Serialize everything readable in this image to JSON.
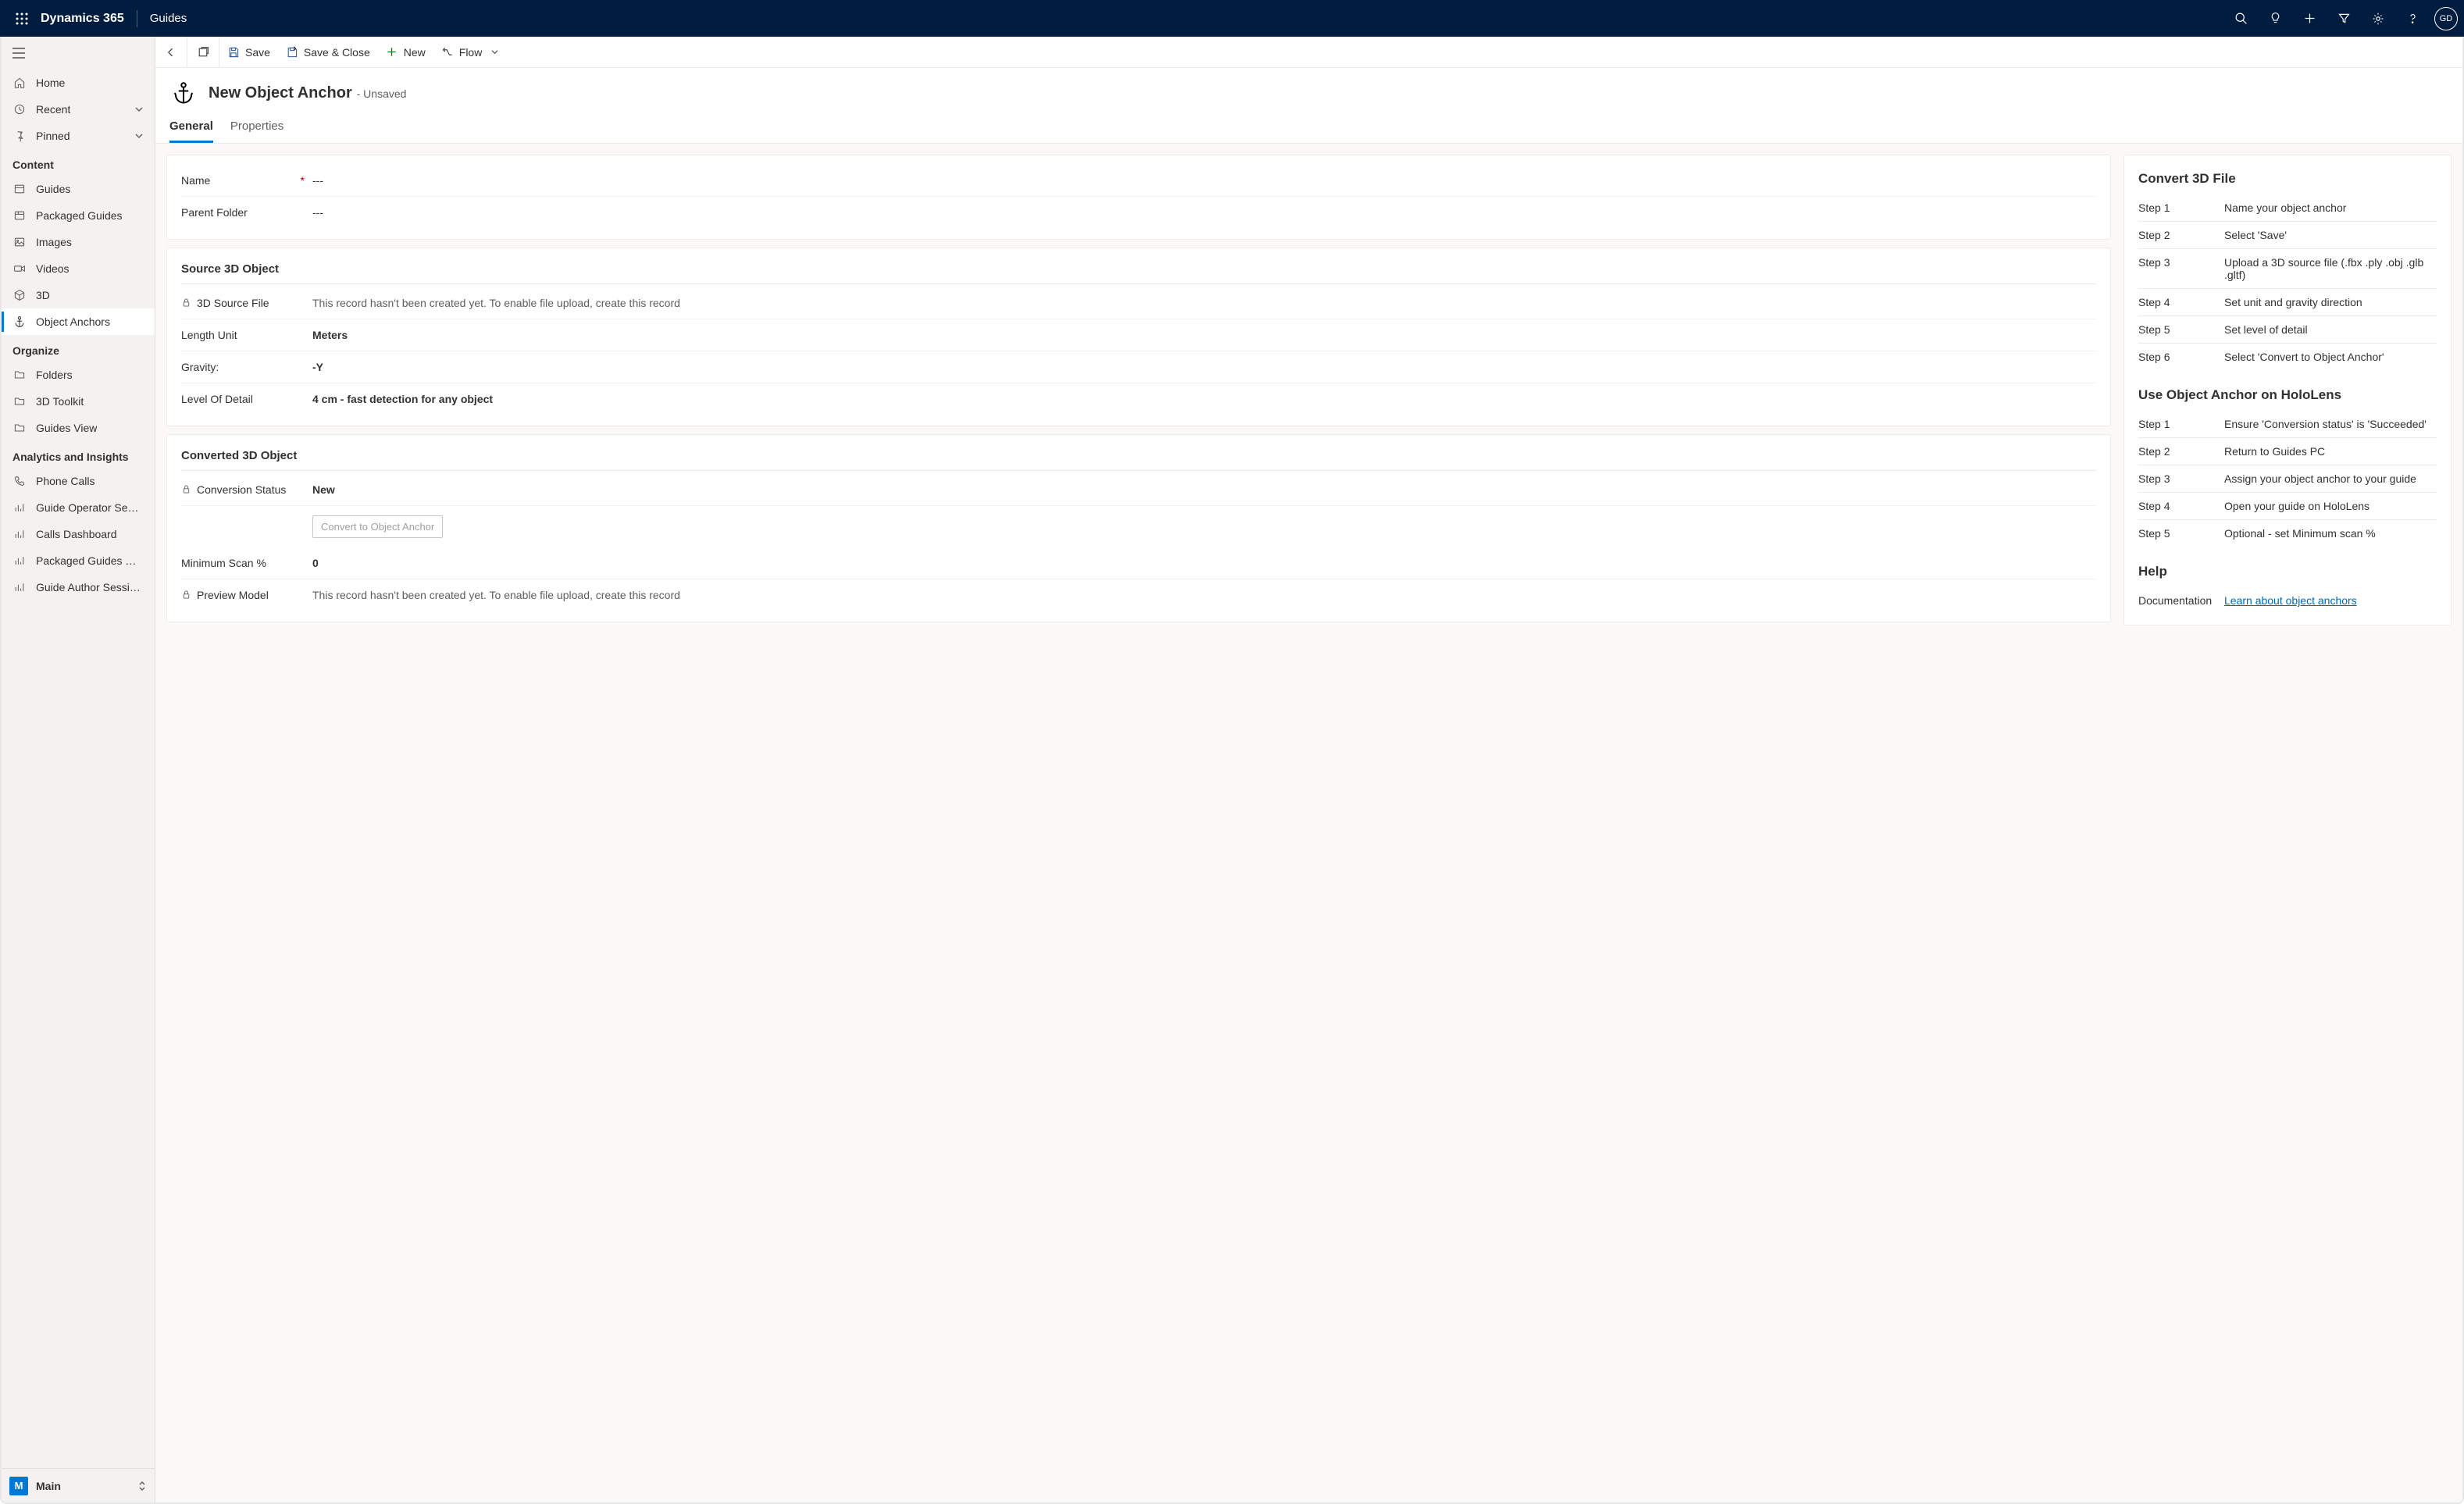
{
  "topbar": {
    "brand": "Dynamics 365",
    "app": "Guides",
    "avatar": "GD"
  },
  "leftnav": {
    "home": "Home",
    "recent": "Recent",
    "pinned": "Pinned",
    "sections": {
      "content": {
        "title": "Content",
        "items": [
          "Guides",
          "Packaged Guides",
          "Images",
          "Videos",
          "3D",
          "Object Anchors"
        ]
      },
      "organize": {
        "title": "Organize",
        "items": [
          "Folders",
          "3D Toolkit",
          "Guides View"
        ]
      },
      "analytics": {
        "title": "Analytics and Insights",
        "items": [
          "Phone Calls",
          "Guide Operator Sessi...",
          "Calls Dashboard",
          "Packaged Guides Op...",
          "Guide Author Sessions"
        ]
      }
    },
    "area": {
      "badge": "M",
      "label": "Main"
    }
  },
  "cmdbar": {
    "save": "Save",
    "save_close": "Save & Close",
    "new": "New",
    "flow": "Flow"
  },
  "record": {
    "title": "New Object Anchor",
    "status": "- Unsaved"
  },
  "tabs": [
    "General",
    "Properties"
  ],
  "form": {
    "name": {
      "label": "Name",
      "value": "---"
    },
    "parent": {
      "label": "Parent Folder",
      "value": "---"
    },
    "source_section": "Source 3D Object",
    "source_file": {
      "label": "3D Source File",
      "value": "This record hasn't been created yet. To enable file upload, create this record"
    },
    "length_unit": {
      "label": "Length Unit",
      "value": "Meters"
    },
    "gravity": {
      "label": "Gravity:",
      "value": "-Y"
    },
    "lod": {
      "label": "Level Of Detail",
      "value": "4 cm - fast detection for any object"
    },
    "converted_section": "Converted 3D Object",
    "conv_status": {
      "label": "Conversion Status",
      "value": "New"
    },
    "convert_btn": "Convert to Object Anchor",
    "min_scan": {
      "label": "Minimum Scan %",
      "value": "0"
    },
    "preview": {
      "label": "Preview Model",
      "value": "This record hasn't been created yet. To enable file upload, create this record"
    }
  },
  "right": {
    "convert_heading": "Convert 3D File",
    "convert_steps": [
      {
        "k": "Step 1",
        "v": "Name your object anchor"
      },
      {
        "k": "Step 2",
        "v": "Select 'Save'"
      },
      {
        "k": "Step 3",
        "v": "Upload a 3D source file (.fbx .ply .obj .glb .gltf)"
      },
      {
        "k": "Step 4",
        "v": "Set unit and gravity direction"
      },
      {
        "k": "Step 5",
        "v": "Set level of detail"
      },
      {
        "k": "Step 6",
        "v": "Select 'Convert to Object Anchor'"
      }
    ],
    "use_heading": "Use Object Anchor on HoloLens",
    "use_steps": [
      {
        "k": "Step 1",
        "v": "Ensure 'Conversion status' is 'Succeeded'"
      },
      {
        "k": "Step 2",
        "v": "Return to Guides PC"
      },
      {
        "k": "Step 3",
        "v": "Assign your object anchor to your guide"
      },
      {
        "k": "Step 4",
        "v": "Open your guide on HoloLens"
      },
      {
        "k": "Step 5",
        "v": "Optional - set Minimum scan %"
      }
    ],
    "help_heading": "Help",
    "help_label": "Documentation",
    "help_link": "Learn about object anchors"
  }
}
